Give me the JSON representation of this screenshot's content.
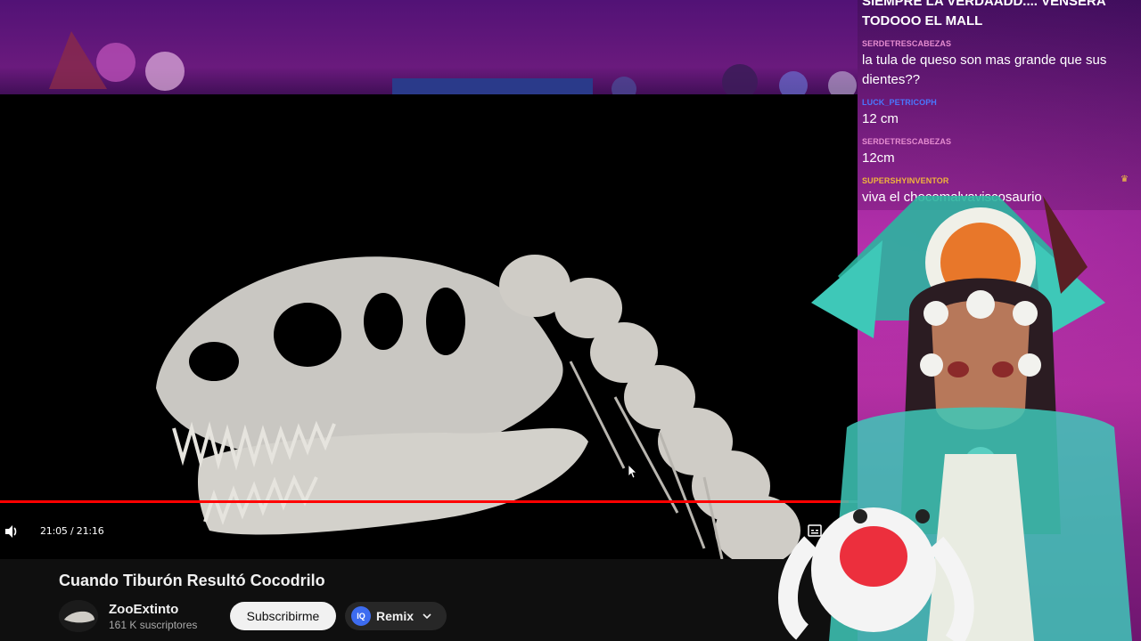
{
  "player": {
    "time_display": "21:05 / 21:16",
    "progress_fraction": 0.99
  },
  "video": {
    "title": "Cuando Tiburón Resultó Cocodrilo"
  },
  "channel": {
    "name": "ZooExtinto",
    "subscribers": "161 K suscriptores",
    "subscribe_label": "Subscribirme",
    "remix_label": "Remix"
  },
  "chat": {
    "messages": [
      {
        "user": "",
        "text": "SIEMPRE LA VERDAADD.... VENSERÁ TODOOO EL MALL",
        "color": "#ffffff"
      },
      {
        "user": "SERDETRESCABEZAS",
        "text": "la tula de queso son mas grande que sus dientes??",
        "color": "#e58cd0"
      },
      {
        "user": "LUCK_PETRICOPH",
        "text": "12 cm",
        "color": "#4a78ff"
      },
      {
        "user": "SERDETRESCABEZAS",
        "text": "12cm",
        "color": "#e58cd0"
      },
      {
        "user": "SUPERSHYINVENTOR",
        "text": "viva el chocomalvaviscosaurio",
        "color": "#f0b43c"
      }
    ]
  },
  "icons": {
    "volume": "volume-icon",
    "captions": "captions-icon",
    "chevron": "chevron-down-icon"
  },
  "colors": {
    "progress": "#ff0000",
    "subscribe_bg": "#f1f1f1",
    "remix_badge": "#3d6cf0"
  }
}
